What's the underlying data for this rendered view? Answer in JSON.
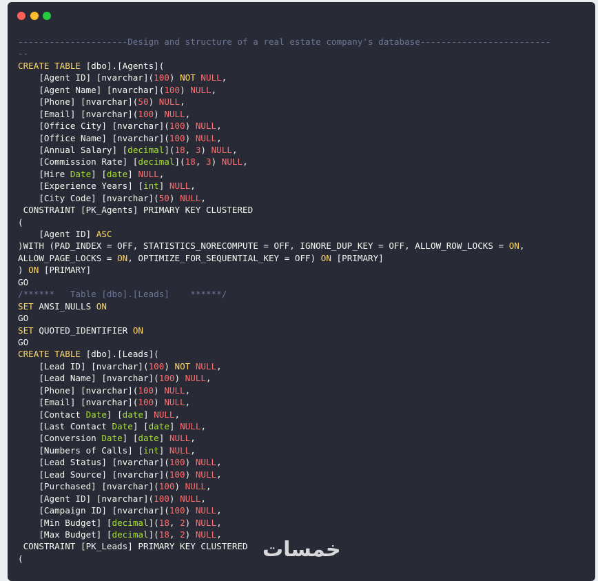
{
  "window": {
    "buttons": [
      "close",
      "minimize",
      "maximize"
    ]
  },
  "colors": {
    "background": "#282a36",
    "keyword": "#ffd866",
    "null_and_numbers": "#ff6e6e",
    "type": "#a6e22e",
    "comment": "#6f7597",
    "text": "#f8f8f2"
  },
  "code_lines": [
    [
      [
        "c",
        "---------------------Design and structure of a real estate company's database-------------------------"
      ]
    ],
    [
      [
        "c",
        "--"
      ]
    ],
    [
      [
        "k",
        "CREATE TABLE"
      ],
      [
        "p",
        " [dbo].[Agents]("
      ]
    ],
    [
      [
        "p",
        "    [Agent ID] [nvarchar]("
      ],
      [
        "n",
        "100"
      ],
      [
        "p",
        ") "
      ],
      [
        "k",
        "NOT"
      ],
      [
        "p",
        " "
      ],
      [
        "x",
        "NULL"
      ],
      [
        "p",
        ","
      ]
    ],
    [
      [
        "p",
        "    [Agent Name] [nvarchar]("
      ],
      [
        "n",
        "100"
      ],
      [
        "p",
        ") "
      ],
      [
        "x",
        "NULL"
      ],
      [
        "p",
        ","
      ]
    ],
    [
      [
        "p",
        "    [Phone] [nvarchar]("
      ],
      [
        "n",
        "50"
      ],
      [
        "p",
        ") "
      ],
      [
        "x",
        "NULL"
      ],
      [
        "p",
        ","
      ]
    ],
    [
      [
        "p",
        "    [Email] [nvarchar]("
      ],
      [
        "n",
        "100"
      ],
      [
        "p",
        ") "
      ],
      [
        "x",
        "NULL"
      ],
      [
        "p",
        ","
      ]
    ],
    [
      [
        "p",
        "    [Office City] [nvarchar]("
      ],
      [
        "n",
        "100"
      ],
      [
        "p",
        ") "
      ],
      [
        "x",
        "NULL"
      ],
      [
        "p",
        ","
      ]
    ],
    [
      [
        "p",
        "    [Office Name] [nvarchar]("
      ],
      [
        "n",
        "100"
      ],
      [
        "p",
        ") "
      ],
      [
        "x",
        "NULL"
      ],
      [
        "p",
        ","
      ]
    ],
    [
      [
        "p",
        "    [Annual Salary] ["
      ],
      [
        "t",
        "decimal"
      ],
      [
        "p",
        "]("
      ],
      [
        "n",
        "18"
      ],
      [
        "p",
        ", "
      ],
      [
        "n",
        "3"
      ],
      [
        "p",
        ") "
      ],
      [
        "x",
        "NULL"
      ],
      [
        "p",
        ","
      ]
    ],
    [
      [
        "p",
        "    [Commission Rate] ["
      ],
      [
        "t",
        "decimal"
      ],
      [
        "p",
        "]("
      ],
      [
        "n",
        "18"
      ],
      [
        "p",
        ", "
      ],
      [
        "n",
        "3"
      ],
      [
        "p",
        ") "
      ],
      [
        "x",
        "NULL"
      ],
      [
        "p",
        ","
      ]
    ],
    [
      [
        "p",
        "    [Hire "
      ],
      [
        "t",
        "Date"
      ],
      [
        "p",
        "] ["
      ],
      [
        "t",
        "date"
      ],
      [
        "p",
        "] "
      ],
      [
        "x",
        "NULL"
      ],
      [
        "p",
        ","
      ]
    ],
    [
      [
        "p",
        "    [Experience Years] ["
      ],
      [
        "t",
        "int"
      ],
      [
        "p",
        "] "
      ],
      [
        "x",
        "NULL"
      ],
      [
        "p",
        ","
      ]
    ],
    [
      [
        "p",
        "    [City Code] [nvarchar]("
      ],
      [
        "n",
        "50"
      ],
      [
        "p",
        ") "
      ],
      [
        "x",
        "NULL"
      ],
      [
        "p",
        ","
      ]
    ],
    [
      [
        "p",
        " CONSTRAINT [PK_Agents] PRIMARY KEY CLUSTERED"
      ]
    ],
    [
      [
        "p",
        "("
      ]
    ],
    [
      [
        "p",
        "    [Agent ID] "
      ],
      [
        "k",
        "ASC"
      ]
    ],
    [
      [
        "p",
        ")WITH (PAD_INDEX = OFF, STATISTICS_NORECOMPUTE = OFF, IGNORE_DUP_KEY = OFF, ALLOW_ROW_LOCKS = "
      ],
      [
        "k",
        "ON"
      ],
      [
        "p",
        ","
      ]
    ],
    [
      [
        "p",
        "ALLOW_PAGE_LOCKS = "
      ],
      [
        "k",
        "ON"
      ],
      [
        "p",
        ", OPTIMIZE_FOR_SEQUENTIAL_KEY = OFF) "
      ],
      [
        "k",
        "ON"
      ],
      [
        "p",
        " [PRIMARY]"
      ]
    ],
    [
      [
        "p",
        ") "
      ],
      [
        "k",
        "ON"
      ],
      [
        "p",
        " [PRIMARY]"
      ]
    ],
    [
      [
        "p",
        "GO"
      ]
    ],
    [
      [
        "c",
        "/******   Table [dbo].[Leads]    ******/"
      ]
    ],
    [
      [
        "k",
        "SET"
      ],
      [
        "p",
        " ANSI_NULLS "
      ],
      [
        "k",
        "ON"
      ]
    ],
    [
      [
        "p",
        "GO"
      ]
    ],
    [
      [
        "k",
        "SET"
      ],
      [
        "p",
        " QUOTED_IDENTIFIER "
      ],
      [
        "k",
        "ON"
      ]
    ],
    [
      [
        "p",
        "GO"
      ]
    ],
    [
      [
        "k",
        "CREATE TABLE"
      ],
      [
        "p",
        " [dbo].[Leads]("
      ]
    ],
    [
      [
        "p",
        "    [Lead ID] [nvarchar]("
      ],
      [
        "n",
        "100"
      ],
      [
        "p",
        ") "
      ],
      [
        "k",
        "NOT"
      ],
      [
        "p",
        " "
      ],
      [
        "x",
        "NULL"
      ],
      [
        "p",
        ","
      ]
    ],
    [
      [
        "p",
        "    [Lead Name] [nvarchar]("
      ],
      [
        "n",
        "100"
      ],
      [
        "p",
        ") "
      ],
      [
        "x",
        "NULL"
      ],
      [
        "p",
        ","
      ]
    ],
    [
      [
        "p",
        "    [Phone] [nvarchar]("
      ],
      [
        "n",
        "100"
      ],
      [
        "p",
        ") "
      ],
      [
        "x",
        "NULL"
      ],
      [
        "p",
        ","
      ]
    ],
    [
      [
        "p",
        "    [Email] [nvarchar]("
      ],
      [
        "n",
        "100"
      ],
      [
        "p",
        ") "
      ],
      [
        "x",
        "NULL"
      ],
      [
        "p",
        ","
      ]
    ],
    [
      [
        "p",
        "    [Contact "
      ],
      [
        "t",
        "Date"
      ],
      [
        "p",
        "] ["
      ],
      [
        "t",
        "date"
      ],
      [
        "p",
        "] "
      ],
      [
        "x",
        "NULL"
      ],
      [
        "p",
        ","
      ]
    ],
    [
      [
        "p",
        "    [Last Contact "
      ],
      [
        "t",
        "Date"
      ],
      [
        "p",
        "] ["
      ],
      [
        "t",
        "date"
      ],
      [
        "p",
        "] "
      ],
      [
        "x",
        "NULL"
      ],
      [
        "p",
        ","
      ]
    ],
    [
      [
        "p",
        "    [Conversion "
      ],
      [
        "t",
        "Date"
      ],
      [
        "p",
        "] ["
      ],
      [
        "t",
        "date"
      ],
      [
        "p",
        "] "
      ],
      [
        "x",
        "NULL"
      ],
      [
        "p",
        ","
      ]
    ],
    [
      [
        "p",
        "    [Numbers of Calls] ["
      ],
      [
        "t",
        "int"
      ],
      [
        "p",
        "] "
      ],
      [
        "x",
        "NULL"
      ],
      [
        "p",
        ","
      ]
    ],
    [
      [
        "p",
        "    [Lead Status] [nvarchar]("
      ],
      [
        "n",
        "100"
      ],
      [
        "p",
        ") "
      ],
      [
        "x",
        "NULL"
      ],
      [
        "p",
        ","
      ]
    ],
    [
      [
        "p",
        "    [Lead Source] [nvarchar]("
      ],
      [
        "n",
        "100"
      ],
      [
        "p",
        ") "
      ],
      [
        "x",
        "NULL"
      ],
      [
        "p",
        ","
      ]
    ],
    [
      [
        "p",
        "    [Purchased] [nvarchar]("
      ],
      [
        "n",
        "100"
      ],
      [
        "p",
        ") "
      ],
      [
        "x",
        "NULL"
      ],
      [
        "p",
        ","
      ]
    ],
    [
      [
        "p",
        "    [Agent ID] [nvarchar]("
      ],
      [
        "n",
        "100"
      ],
      [
        "p",
        ") "
      ],
      [
        "x",
        "NULL"
      ],
      [
        "p",
        ","
      ]
    ],
    [
      [
        "p",
        "    [Campaign ID] [nvarchar]("
      ],
      [
        "n",
        "100"
      ],
      [
        "p",
        ") "
      ],
      [
        "x",
        "NULL"
      ],
      [
        "p",
        ","
      ]
    ],
    [
      [
        "p",
        "    [Min Budget] ["
      ],
      [
        "t",
        "decimal"
      ],
      [
        "p",
        "]("
      ],
      [
        "n",
        "18"
      ],
      [
        "p",
        ", "
      ],
      [
        "n",
        "2"
      ],
      [
        "p",
        ") "
      ],
      [
        "x",
        "NULL"
      ],
      [
        "p",
        ","
      ]
    ],
    [
      [
        "p",
        "    [Max Budget] ["
      ],
      [
        "t",
        "decimal"
      ],
      [
        "p",
        "]("
      ],
      [
        "n",
        "18"
      ],
      [
        "p",
        ", "
      ],
      [
        "n",
        "2"
      ],
      [
        "p",
        ") "
      ],
      [
        "x",
        "NULL"
      ],
      [
        "p",
        ","
      ]
    ],
    [
      [
        "p",
        " CONSTRAINT [PK_Leads] PRIMARY KEY CLUSTERED"
      ]
    ],
    [
      [
        "p",
        "("
      ]
    ]
  ],
  "watermark": {
    "text": "خمسات"
  }
}
